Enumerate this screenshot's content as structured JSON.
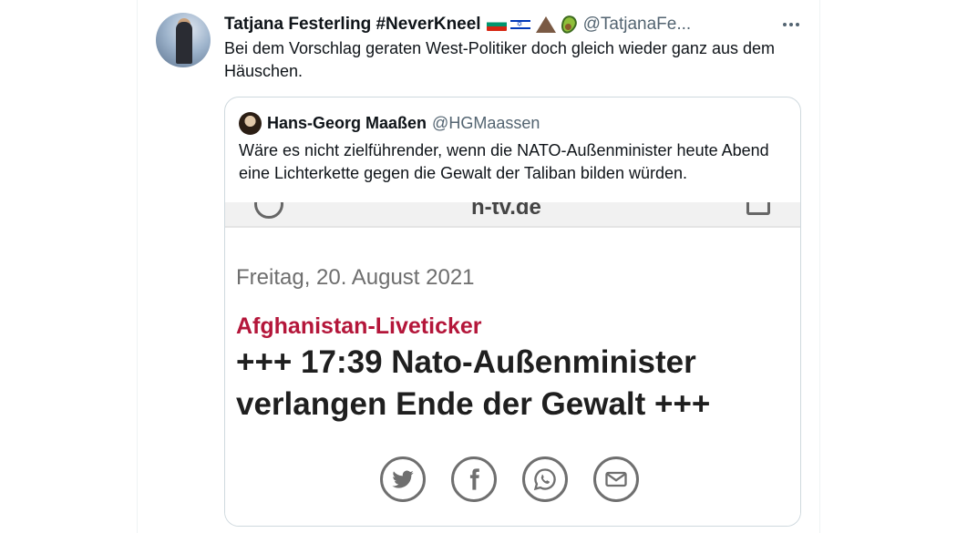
{
  "tweet": {
    "display_name": "Tatjana Festerling #NeverKneel",
    "emoji_icons": [
      "bulgaria-flag-icon",
      "israel-flag-icon",
      "volcano-icon",
      "avocado-icon"
    ],
    "handle": "@TatjanaFe...",
    "text": "Bei dem Vorschlag geraten West-Politiker doch gleich wieder ganz aus dem Häuschen.",
    "more_icon": "more-dots-icon"
  },
  "quoted": {
    "display_name": "Hans-Georg Maaßen",
    "handle": "@HGMaassen",
    "text": "Wäre es nicht zielführender, wenn die NATO-Außenminister heute Abend eine Lichterkette gegen die Gewalt der Taliban bilden würden.",
    "media": {
      "bar_text": "n-tv.de",
      "date": "Freitag, 20. August 2021",
      "kicker": "Afghanistan-Liveticker",
      "headline": "+++ 17:39 Nato-Außenminister verlangen Ende der Gewalt +++",
      "share_icons": [
        "twitter-icon",
        "facebook-icon",
        "whatsapp-icon",
        "email-icon"
      ]
    }
  },
  "colors": {
    "text": "#0f1419",
    "secondary": "#536471",
    "border": "#cfd9de",
    "kicker_red": "#b4163a"
  }
}
